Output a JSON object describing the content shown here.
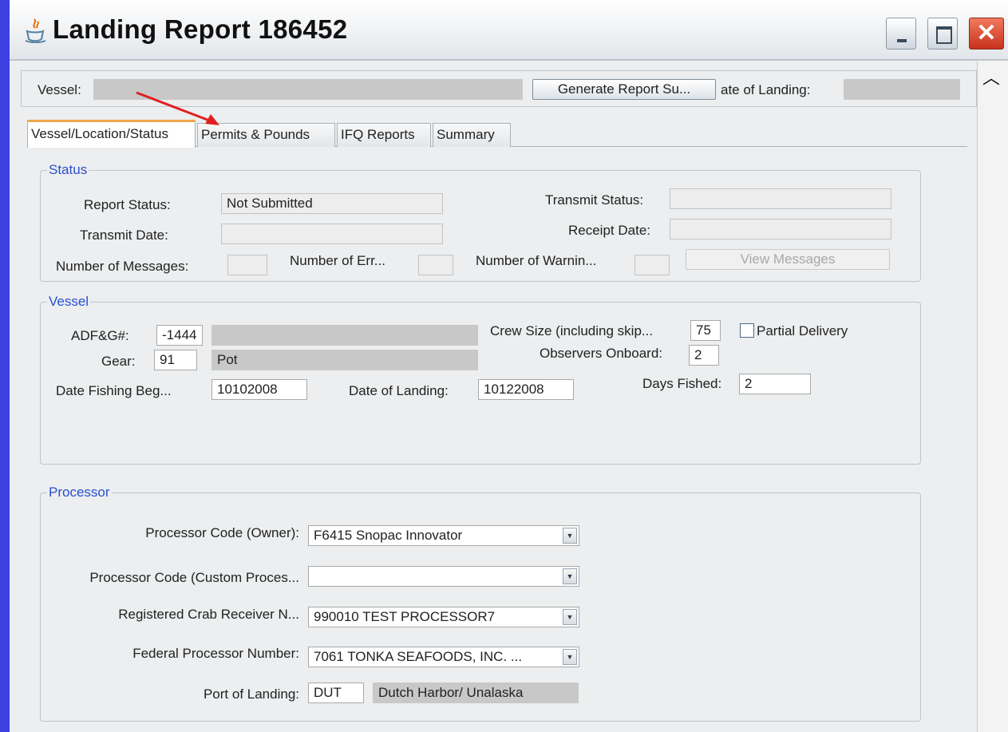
{
  "window": {
    "title": "Landing Report 186452",
    "close_glyph": "✕"
  },
  "top": {
    "vessel_label": "Vessel:",
    "generate_button": "Generate Report Su...",
    "date_of_landing_label": "ate of Landing:"
  },
  "tabs": [
    {
      "label": "Vessel/Location/Status",
      "active": true
    },
    {
      "label": "Permits & Pounds",
      "active": false
    },
    {
      "label": "IFQ Reports",
      "active": false
    },
    {
      "label": "Summary",
      "active": false
    }
  ],
  "status": {
    "title": "Status",
    "report_status_label": "Report Status:",
    "report_status_value": "Not Submitted",
    "transmit_status_label": "Transmit Status:",
    "transmit_date_label": "Transmit Date:",
    "receipt_date_label": "Receipt Date:",
    "num_messages_label": "Number of Messages:",
    "num_errors_label": "Number of Err...",
    "num_warnings_label": "Number of Warnin...",
    "view_messages_button": "View Messages"
  },
  "vessel": {
    "title": "Vessel",
    "adfg_label": "ADF&G#:",
    "adfg_value": "-1444",
    "gear_label": "Gear:",
    "gear_code": "91",
    "gear_name": "Pot",
    "date_fishing_began_label": "Date Fishing Beg...",
    "date_fishing_began_value": "10102008",
    "date_of_landing_label": "Date of Landing:",
    "date_of_landing_value": "10122008",
    "crew_size_label": "Crew Size (including skip...",
    "crew_size_value": "75",
    "partial_delivery_label": "Partial Delivery",
    "partial_delivery_checked": false,
    "observers_label": "Observers Onboard:",
    "observers_value": "2",
    "days_fished_label": "Days Fished:",
    "days_fished_value": "2"
  },
  "processor": {
    "title": "Processor",
    "owner_label": "Processor Code (Owner):",
    "owner_value": "F6415 Snopac Innovator",
    "custom_label": "Processor Code (Custom Proces...",
    "custom_value": "",
    "crab_receiver_label": "Registered Crab Receiver N...",
    "crab_receiver_value": "990010 TEST PROCESSOR7",
    "federal_label": "Federal Processor Number:",
    "federal_value": "7061 TONKA SEAFOODS, INC. ...",
    "port_label": "Port of Landing:",
    "port_code": "DUT",
    "port_name": "Dutch Harbor/ Unalaska"
  },
  "colors": {
    "group_title": "#2a4fcf",
    "active_tab_accent": "#f0a64a",
    "annotation_arrow": "#e02020",
    "outer_background": "#3d3fe0"
  },
  "icons": {
    "app": "java-icon",
    "scroll_up": "chevron-up-icon",
    "dropdown": "chevron-down-icon"
  }
}
